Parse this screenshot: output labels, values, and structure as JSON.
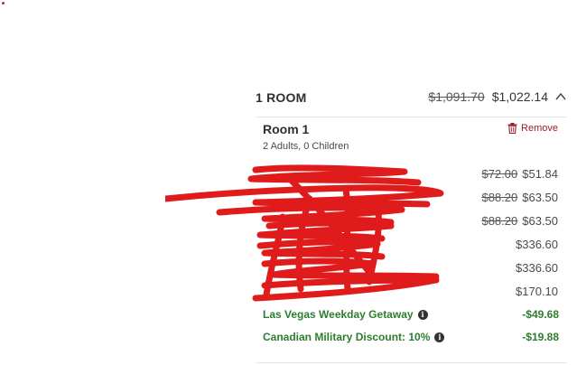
{
  "summary": {
    "room_count": "1 ROOM",
    "original_total": "$1,091.70",
    "total": "$1,022.14",
    "collapse_icon": "chevron-up-icon"
  },
  "room": {
    "title": "Room 1",
    "guests": "2 Adults, 0 Children",
    "remove_label": "Remove",
    "remove_icon": "trash-icon"
  },
  "price_rows": [
    {
      "original": "$72.00",
      "price": "$51.84"
    },
    {
      "original": "$88.20",
      "price": "$63.50"
    },
    {
      "original": "$88.20",
      "price": "$63.50"
    },
    {
      "original": "",
      "price": "$336.60"
    },
    {
      "original": "",
      "price": "$336.60"
    },
    {
      "original": "",
      "price": "$170.10"
    }
  ],
  "discounts": [
    {
      "name": "Las Vegas Weekday Getaway",
      "amount": "-$49.68"
    },
    {
      "name": "Canadian Military Discount: 10%",
      "amount": "-$19.88"
    }
  ],
  "colors": {
    "accent_remove": "#9b1c2c",
    "discount_green": "#2e7d2e",
    "scribble_red": "#e01414"
  }
}
